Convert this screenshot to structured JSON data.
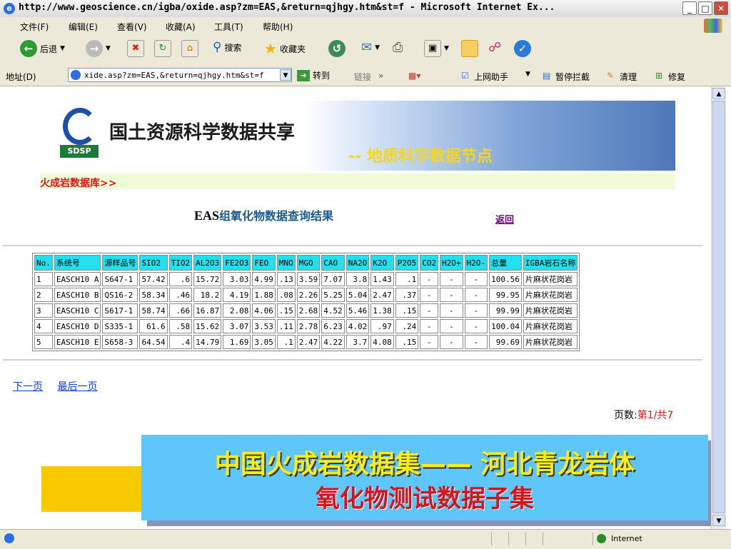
{
  "window": {
    "title": "http://www.geoscience.cn/igba/oxide.asp?zm=EAS,&return=qjhgy.htm&st=f - Microsoft Internet Ex...",
    "controls": [
      "_",
      "□",
      "✕"
    ]
  },
  "menu": [
    "文件(F)",
    "编辑(E)",
    "查看(V)",
    "收藏(A)",
    "工具(T)",
    "帮助(H)"
  ],
  "toolbar": {
    "back": "后退",
    "search": "搜索",
    "favorites": "收藏夹"
  },
  "addressbar": {
    "label": "地址(D)",
    "url": "xide.asp?zm=EAS,&return=qjhgy.htm&st=f",
    "go": "转到",
    "links": "链接",
    "assistant": "上网助手",
    "popup_block": "暂停拦截",
    "clean": "清理",
    "repair": "修复"
  },
  "banner": {
    "logo_text": "SDSP",
    "title": "国土资源科学数据共享",
    "subtitle": "-- 地质科学数据节点"
  },
  "breadcrumb": "火成岩数据库>>",
  "query": {
    "title_latin": "EAS",
    "title_cn": "组氧化物数据查询结果",
    "back_link": "返回"
  },
  "table": {
    "columns": [
      "No.",
      "系统号",
      "源样品号",
      "SIO2",
      "TIO2",
      "AL2O3",
      "FE2O3",
      "FEO",
      "MNO",
      "MGO",
      "CAO",
      "NA2O",
      "K2O",
      "P2O5",
      "CO2",
      "H2O+",
      "H2O-",
      "总量",
      "IGBA岩石名称"
    ],
    "rows": [
      [
        "1",
        "EASCH10 A",
        "S647-1",
        "57.42",
        ".6",
        "15.72",
        "3.03",
        "4.99",
        ".13",
        "3.59",
        "7.07",
        "3.8",
        "1.43",
        ".1",
        "-",
        "-",
        "-",
        "100.56",
        "片麻状花岗岩"
      ],
      [
        "2",
        "EASCH10 B",
        "QS16-2",
        "58.34",
        ".46",
        "18.2",
        "4.19",
        "1.88",
        ".08",
        "2.26",
        "5.25",
        "5.04",
        "2.47",
        ".37",
        "-",
        "-",
        "-",
        "99.95",
        "片麻状花岗岩"
      ],
      [
        "3",
        "EASCH10 C",
        "S617-1",
        "58.74",
        ".66",
        "16.87",
        "2.08",
        "4.06",
        ".15",
        "2.68",
        "4.52",
        "5.46",
        "1.38",
        ".15",
        "-",
        "-",
        "-",
        "99.99",
        "片麻状花岗岩"
      ],
      [
        "4",
        "EASCH10 D",
        "S335-1",
        "61.6",
        ".58",
        "15.62",
        "3.07",
        "3.53",
        ".11",
        "2.78",
        "6.23",
        "4.02",
        ".97",
        ".24",
        "-",
        "-",
        "-",
        "100.04",
        "片麻状花岗岩"
      ],
      [
        "5",
        "EASCH10 E",
        "S658-3",
        "64.54",
        ".4",
        "14.79",
        "1.69",
        "3.05",
        ".1",
        "2.47",
        "4.22",
        "3.7",
        "4.08",
        ".15",
        "-",
        "-",
        "-",
        "99.69",
        "片麻状花岗岩"
      ]
    ]
  },
  "nav": {
    "next": "下一页",
    "last": "最后一页",
    "page_label": "页数:",
    "page_value": "第1/共7"
  },
  "overlay": {
    "line1": "中国火成岩数据集—— 河北青龙岩体",
    "line2": "氧化物测试数据子集"
  },
  "status": {
    "zone": "Internet"
  },
  "colors": {
    "table_header": "#22e0ee",
    "overlay_bg": "#5ec6f8",
    "overlay_line1": "#f7ee18",
    "overlay_line2": "#d8121a",
    "link": "#0b3bd0"
  }
}
